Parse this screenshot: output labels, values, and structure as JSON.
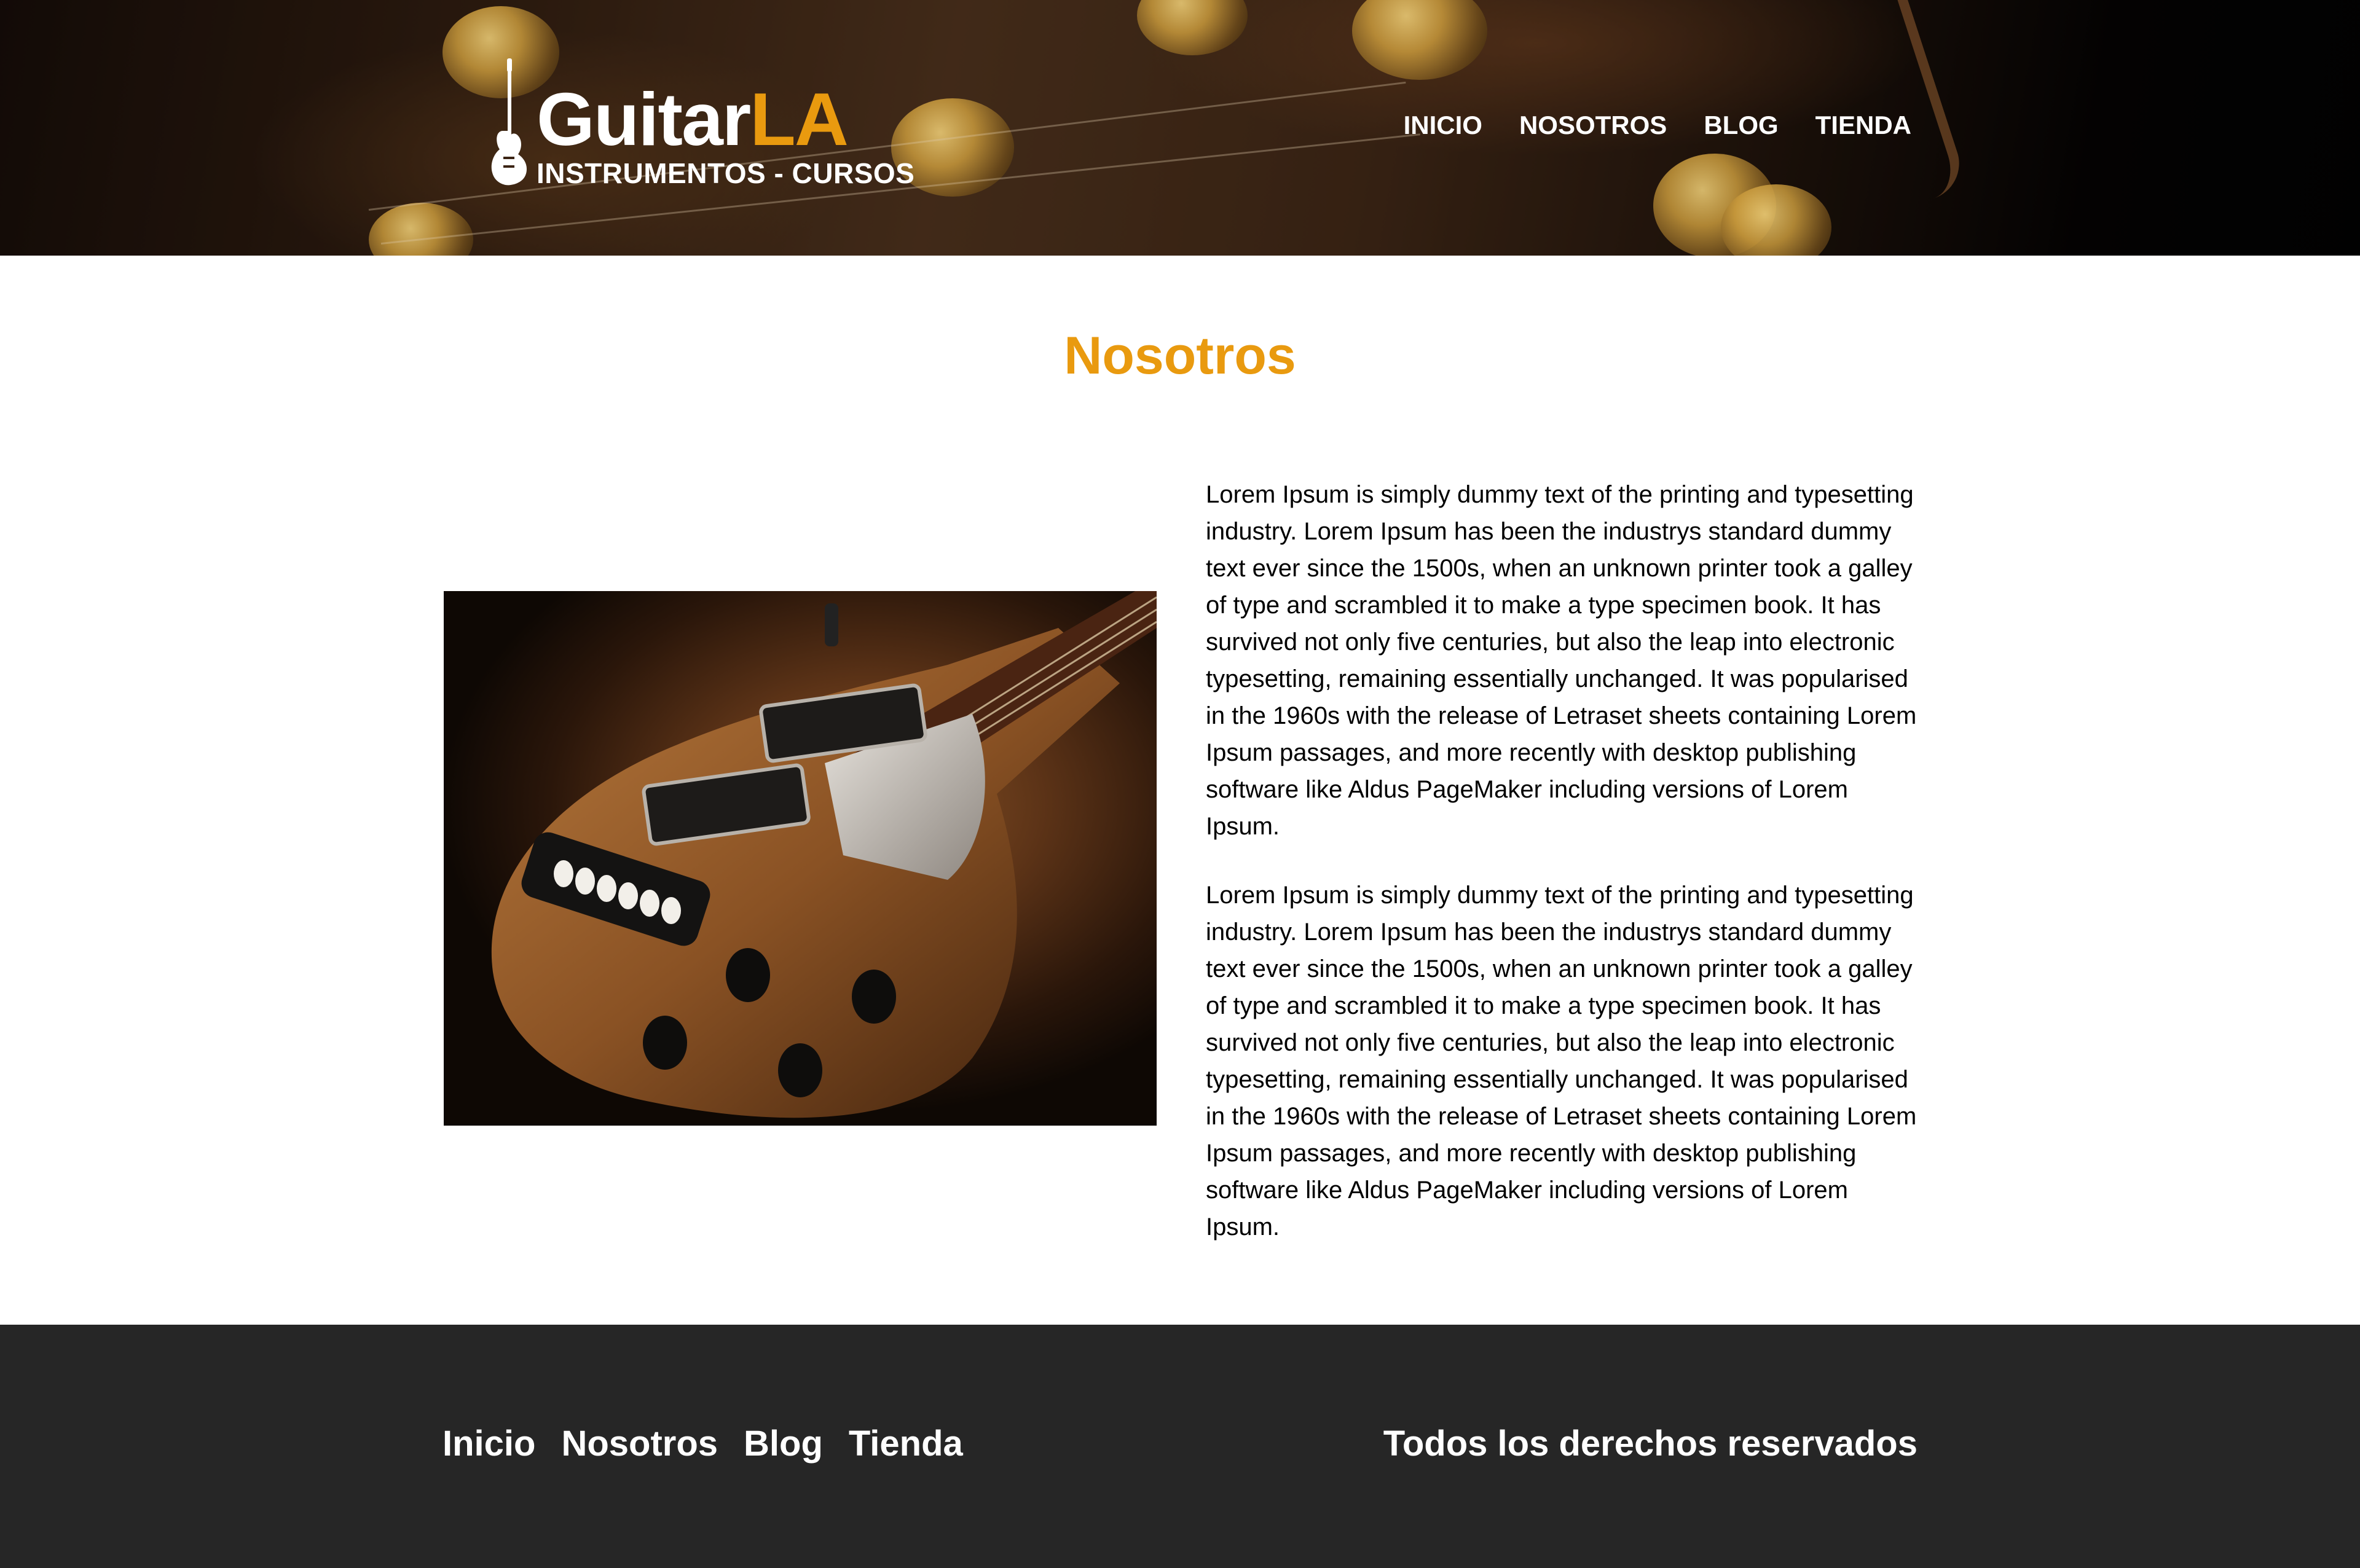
{
  "logo": {
    "brand_main": "Guitar",
    "brand_accent": "LA",
    "tagline": "INSTRUMENTOS - CURSOS"
  },
  "nav": {
    "items": [
      "INICIO",
      "NOSOTROS",
      "BLOG",
      "TIENDA"
    ]
  },
  "main": {
    "title": "Nosotros",
    "paragraphs": [
      "Lorem Ipsum is simply dummy text of the printing and typesetting industry. Lorem Ipsum has been the industrys standard dummy text ever since the 1500s, when an unknown printer took a galley of type and scrambled it to make a type specimen book. It has survived not only five centuries, but also the leap into electronic typesetting, remaining essentially unchanged. It was popularised in the 1960s with the release of Letraset sheets containing Lorem Ipsum passages, and more recently with desktop publishing software like Aldus PageMaker including versions of Lorem Ipsum.",
      "Lorem Ipsum is simply dummy text of the printing and typesetting industry. Lorem Ipsum has been the industrys standard dummy text ever since the 1500s, when an unknown printer took a galley of type and scrambled it to make a type specimen book. It has survived not only five centuries, but also the leap into electronic typesetting, remaining essentially unchanged. It was popularised in the 1960s with the release of Letraset sheets containing Lorem Ipsum passages, and more recently with desktop publishing software like Aldus PageMaker including versions of Lorem Ipsum."
    ]
  },
  "footer": {
    "nav_items": [
      "Inicio",
      "Nosotros",
      "Blog",
      "Tienda"
    ],
    "copyright": "Todos los derechos reservados"
  },
  "colors": {
    "accent": "#e99a0f",
    "footer_bg": "#262626",
    "text": "#000000"
  },
  "icons": {
    "logo": "electric-guitar-icon"
  }
}
